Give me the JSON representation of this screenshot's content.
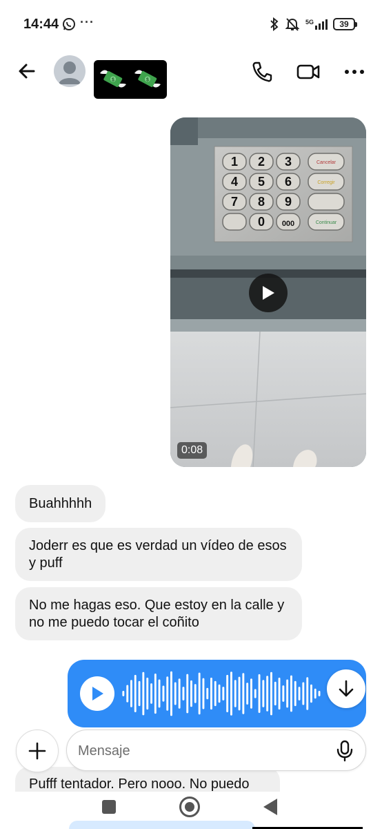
{
  "status_bar": {
    "time": "14:44",
    "dots": "···",
    "network": "5G",
    "battery": "39",
    "icons": [
      "whatsapp-icon",
      "bluetooth-icon",
      "mute-icon",
      "signal-icon",
      "battery-icon"
    ]
  },
  "header": {
    "icons": [
      "back-arrow-icon",
      "avatar",
      "money-with-wings-emoji",
      "phone-icon",
      "video-camera-icon",
      "more-icon"
    ]
  },
  "video_message": {
    "duration": "0:08",
    "keypad_keys": [
      "1",
      "2",
      "3",
      "4",
      "5",
      "6",
      "7",
      "8",
      "9",
      "0",
      "000"
    ],
    "function_keys": [
      "Cancelar",
      "Corregir",
      "",
      "Continuar"
    ]
  },
  "messages": [
    {
      "direction": "in",
      "text": "Buahhhhh"
    },
    {
      "direction": "in",
      "text": "Joderr es que es verdad un vídeo de esos y puff"
    },
    {
      "direction": "in",
      "text": "No me hagas eso. Que estoy en la calle y no me puedo tocar el coñito"
    }
  ],
  "voice_message": {
    "color": "#2f8cf7",
    "waveform": [
      0.12,
      0.38,
      0.6,
      0.82,
      0.55,
      0.95,
      0.7,
      0.45,
      0.88,
      0.62,
      0.35,
      0.75,
      0.98,
      0.5,
      0.66,
      0.3,
      0.86,
      0.58,
      0.42,
      0.92,
      0.68,
      0.25,
      0.7,
      0.55,
      0.4,
      0.3,
      0.82,
      0.96,
      0.6,
      0.74,
      0.9,
      0.48,
      0.66,
      0.2,
      0.85,
      0.6,
      0.78,
      0.95,
      0.52,
      0.7,
      0.36,
      0.62,
      0.8,
      0.55,
      0.3,
      0.5,
      0.72,
      0.4,
      0.22,
      0.12
    ]
  },
  "composer": {
    "placeholder": "Mensaje"
  },
  "partial_message": "Pufff tentador. Pero nooo. No puedo"
}
